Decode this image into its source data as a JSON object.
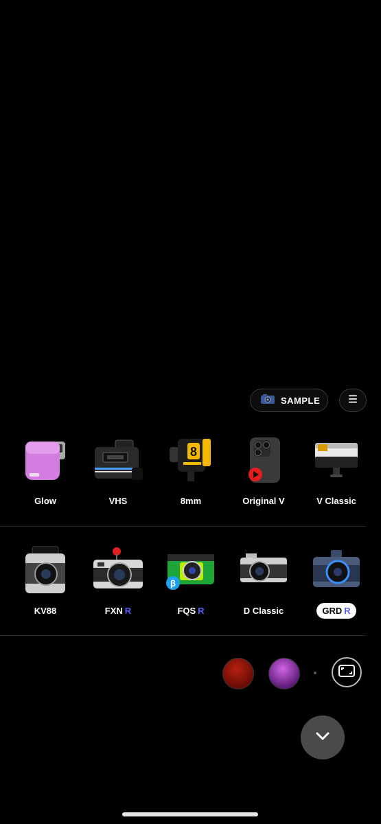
{
  "toolbar": {
    "sample_label": "SAMPLE"
  },
  "row1": [
    {
      "name": "Glow",
      "r": ""
    },
    {
      "name": "VHS",
      "r": ""
    },
    {
      "name": "8mm",
      "r": ""
    },
    {
      "name": "Original V",
      "r": ""
    },
    {
      "name": "V Classic",
      "r": ""
    }
  ],
  "row2": [
    {
      "name": "KV88",
      "r": ""
    },
    {
      "name": "FXN",
      "r": "R"
    },
    {
      "name": "FQS",
      "r": "R"
    },
    {
      "name": "D Classic",
      "r": ""
    },
    {
      "name": "GRD",
      "r": "R"
    }
  ],
  "icons": {
    "camera_small": "camera-icon",
    "menu": "menu-icon",
    "aspect": "aspect-ratio-icon",
    "chevron": "chevron-down-icon"
  },
  "colors": {
    "accent_r": "#5c5cff",
    "background": "#000000"
  }
}
